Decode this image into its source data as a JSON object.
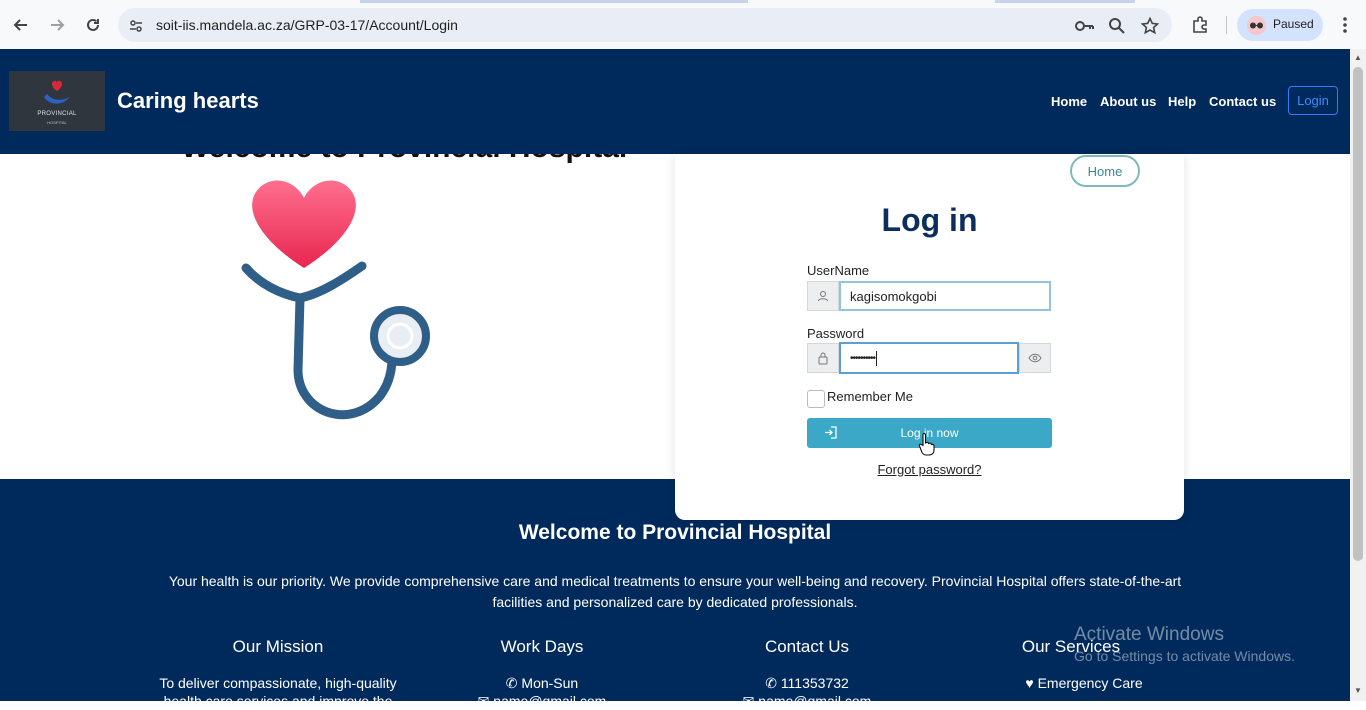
{
  "browser": {
    "url": "soit-iis.mandela.ac.za/GRP-03-17/Account/Login",
    "profile_status": "Paused",
    "icons": [
      "back-icon",
      "forward-icon",
      "reload-icon",
      "site-info-icon",
      "key-icon",
      "zoom-icon",
      "star-icon",
      "extensions-icon",
      "menu-icon"
    ]
  },
  "header": {
    "logo_text": "PROVINCIAL",
    "logo_sub": "HOSPITAL",
    "site_title": "Caring hearts",
    "nav": [
      "Home",
      "About us",
      "Help",
      "Contact us"
    ],
    "login_label": "Login"
  },
  "hero": {
    "title": "Welcome to Provincial Hospital"
  },
  "login": {
    "home_label": "Home",
    "title": "Log in",
    "username_label": "UserName",
    "username_value": "kagisomokgobi",
    "password_label": "Password",
    "password_value": "••••••••••",
    "remember_label": "Remember Me",
    "submit_label": "Log in now",
    "forgot_label": "Forgot password?"
  },
  "footer": {
    "title": "Welcome to Provincial Hospital",
    "description": "Your health is our priority. We provide comprehensive care and medical treatments to ensure your well-being and recovery. Provincial Hospital offers state-of-the-art facilities and personalized care by dedicated professionals.",
    "columns": [
      {
        "heading": "Our Mission",
        "item": "To deliver compassionate, high-quality",
        "item2": "health care services and improve the"
      },
      {
        "heading": "Work Days",
        "item": "Mon-Sun",
        "item2": "name@gmail.com"
      },
      {
        "heading": "Contact Us",
        "item": "111353732",
        "item2": "name@gmail.com"
      },
      {
        "heading": "Our Services",
        "item": "Emergency Care",
        "item2": ""
      }
    ]
  },
  "os_watermark": {
    "line1": "Activate Windows",
    "line2": "Go to Settings to activate Windows."
  },
  "colors": {
    "brand_navy": "#002a5c",
    "accent_teal": "#3aa8c6",
    "login_blue": "#3d8bfd"
  }
}
